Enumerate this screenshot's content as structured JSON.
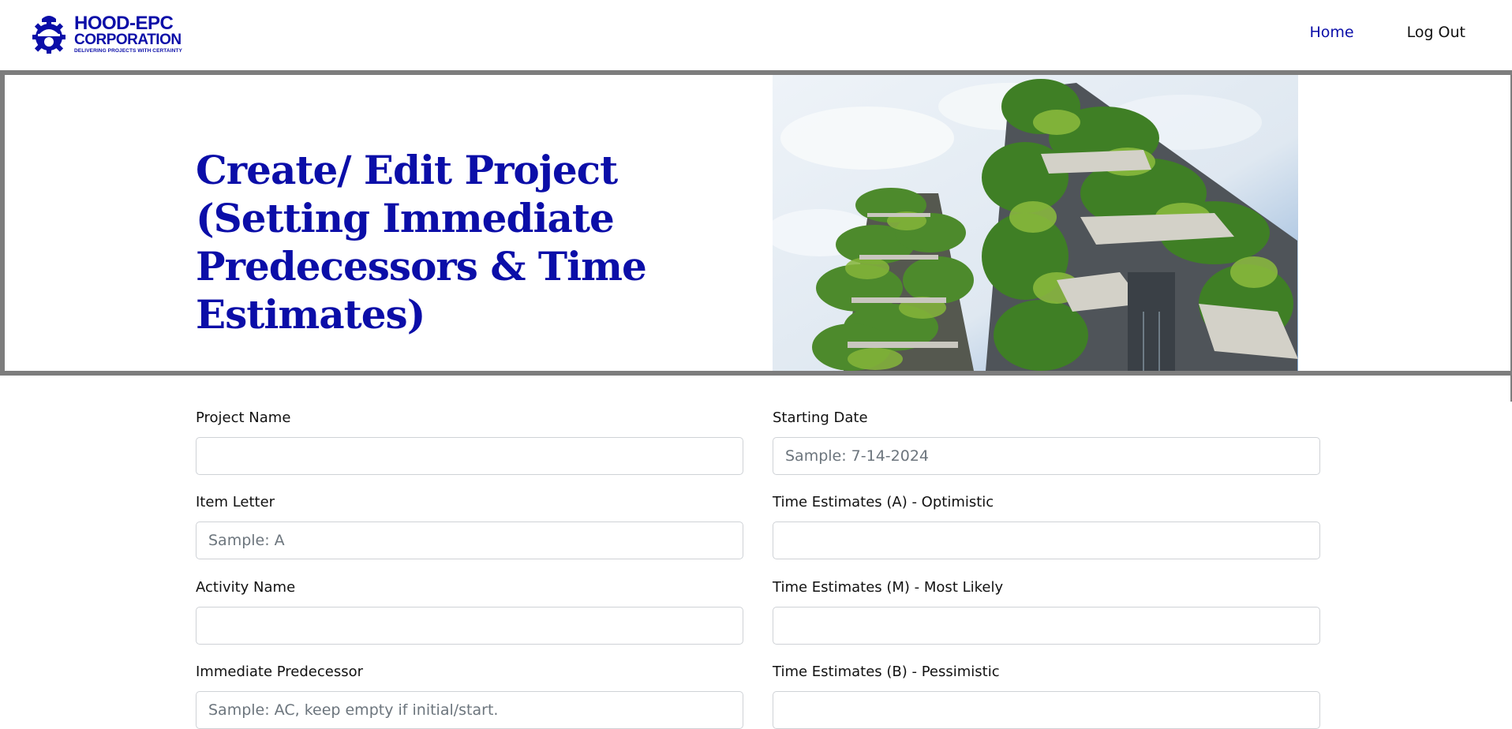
{
  "brand": {
    "name_line1": "HOOD-EPC",
    "name_line2": "CORPORATION",
    "tagline": "DELIVERING PROJECTS WITH CERTAINTY",
    "color": "#0b0ea8"
  },
  "nav": {
    "home_label": "Home",
    "logout_label": "Log Out"
  },
  "hero": {
    "title": "Create/ Edit Project (Setting Immediate Predecessors & Time Estimates)",
    "image_icon": "green-towers-photo"
  },
  "form": {
    "left": [
      {
        "label": "Project Name",
        "placeholder": "",
        "value": ""
      },
      {
        "label": "Item Letter",
        "placeholder": "Sample: A",
        "value": ""
      },
      {
        "label": "Activity Name",
        "placeholder": "",
        "value": ""
      },
      {
        "label": "Immediate Predecessor",
        "placeholder": "Sample: AC, keep empty if initial/start.",
        "value": ""
      }
    ],
    "right": [
      {
        "label": "Starting Date",
        "placeholder": "Sample: 7-14-2024",
        "value": ""
      },
      {
        "label": "Time Estimates (A) - Optimistic",
        "placeholder": "",
        "value": ""
      },
      {
        "label": "Time Estimates (M) - Most Likely",
        "placeholder": "",
        "value": ""
      },
      {
        "label": "Time Estimates (B) - Pessimistic",
        "placeholder": "",
        "value": ""
      }
    ]
  },
  "colors": {
    "accent": "#0b0ea8",
    "border": "#7d7d7d"
  }
}
